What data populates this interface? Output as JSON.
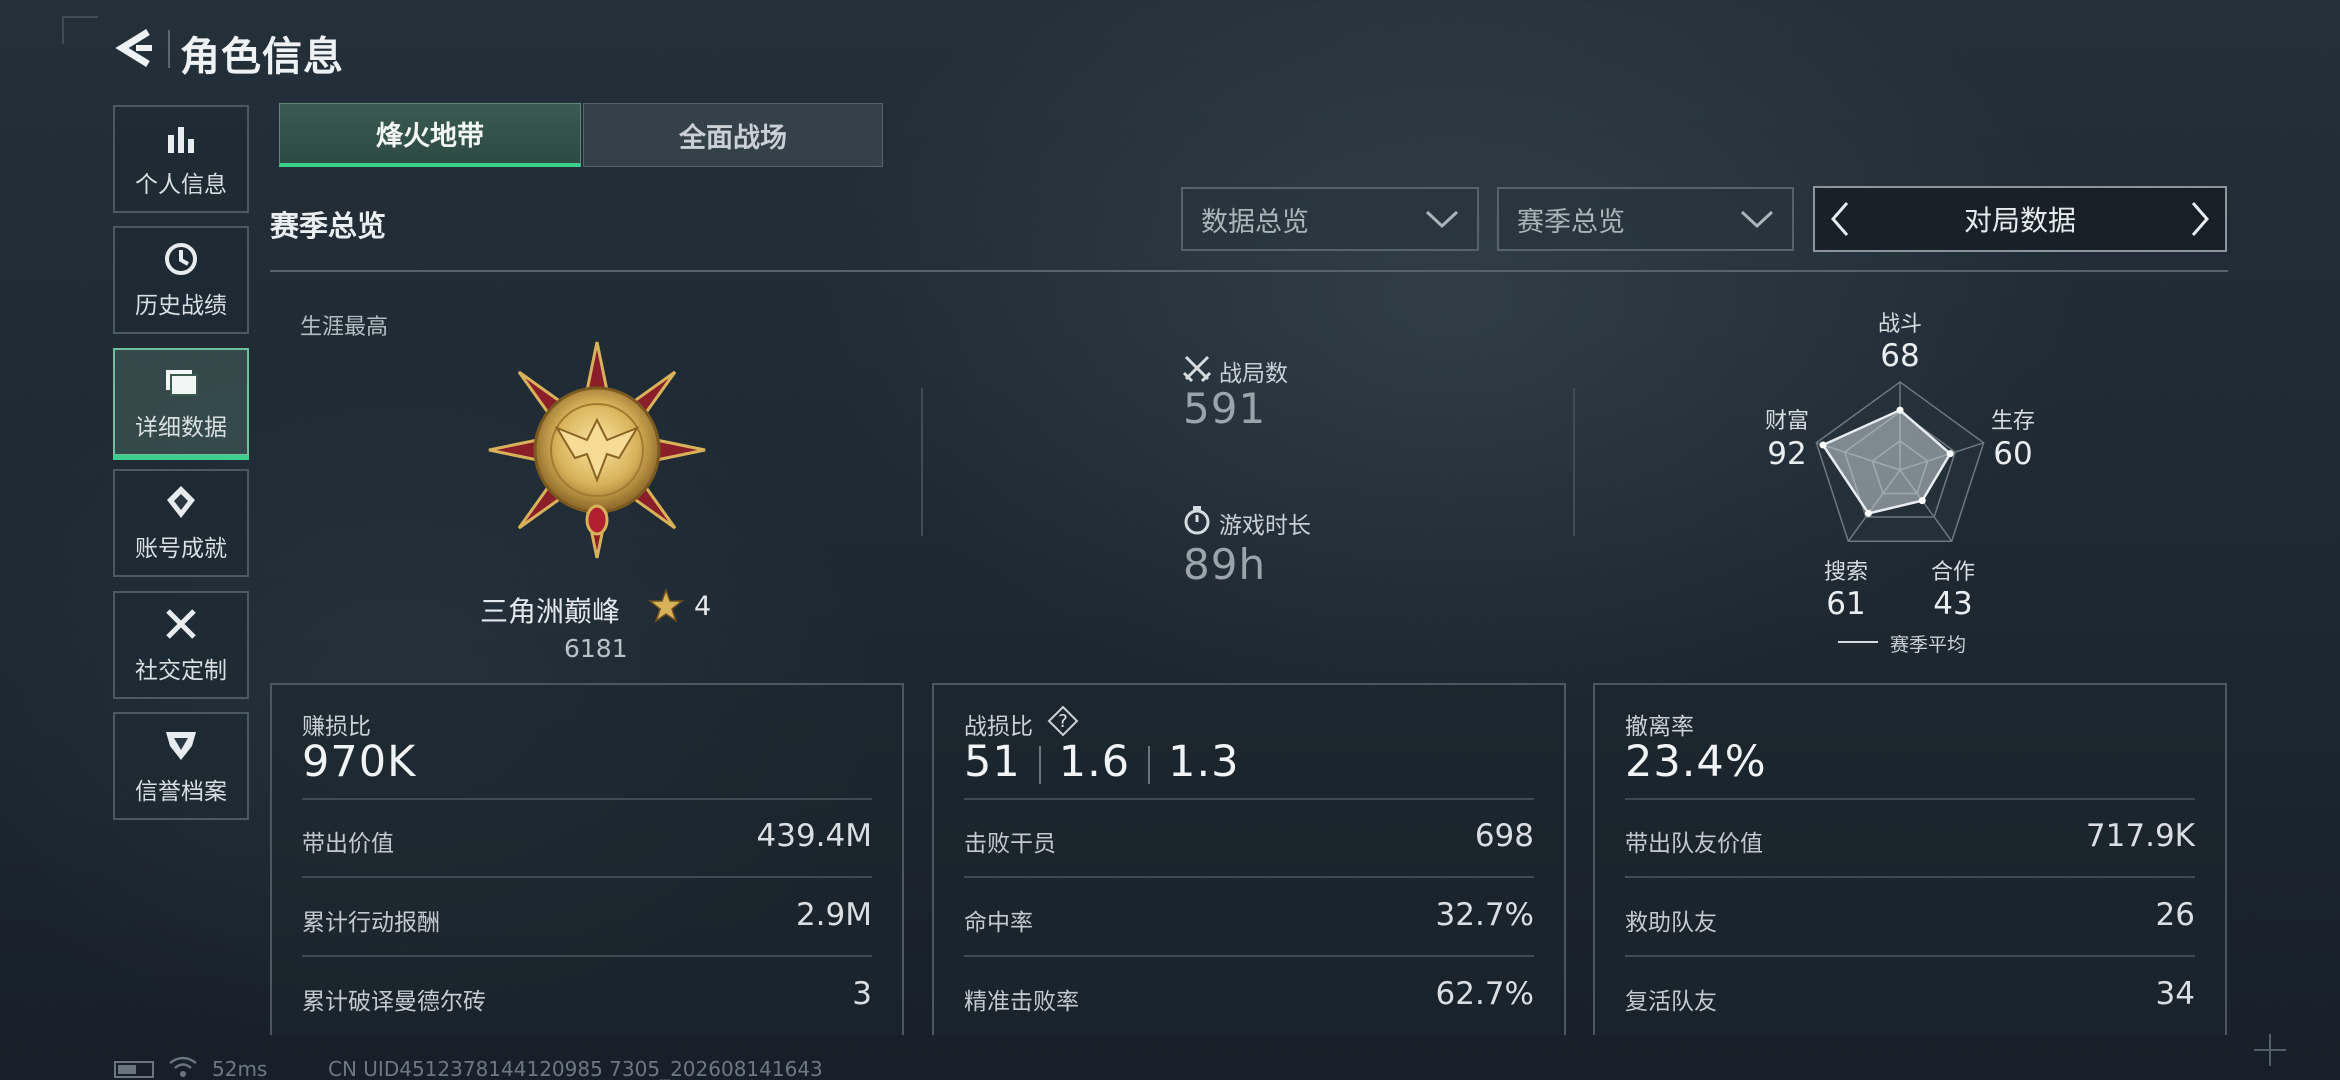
{
  "header": {
    "title": "角色信息"
  },
  "sidebar": {
    "items": [
      {
        "label": "个人信息",
        "icon": "bar-chart-icon"
      },
      {
        "label": "历史战绩",
        "icon": "clock-icon"
      },
      {
        "label": "详细数据",
        "icon": "folder-icon",
        "active": true
      },
      {
        "label": "账号成就",
        "icon": "medal-icon"
      },
      {
        "label": "社交定制",
        "icon": "tools-icon"
      },
      {
        "label": "信誉档案",
        "icon": "shield-icon"
      }
    ]
  },
  "tabs": [
    {
      "label": "烽火地带",
      "active": true
    },
    {
      "label": "全面战场",
      "active": false
    }
  ],
  "section_title": "赛季总览",
  "filters": {
    "dropdown1": "数据总览",
    "dropdown2": "赛季总览",
    "switcher": "对局数据"
  },
  "career": {
    "label": "生涯最高",
    "rank_name": "三角洲巅峰",
    "stars": "4",
    "score": "6181"
  },
  "match_stats": {
    "matches_label": "战局数",
    "matches_value": "591",
    "playtime_label": "游戏时长",
    "playtime_value": "89h"
  },
  "radar": {
    "axes": [
      {
        "label": "战斗",
        "value": "68"
      },
      {
        "label": "生存",
        "value": "60"
      },
      {
        "label": "合作",
        "value": "43"
      },
      {
        "label": "搜索",
        "value": "61"
      },
      {
        "label": "财富",
        "value": "92"
      }
    ],
    "legend": "赛季平均"
  },
  "cards": [
    {
      "title": "赚损比",
      "big": "970K",
      "rows": [
        {
          "label": "带出价值",
          "value": "439.4M"
        },
        {
          "label": "累计行动报酬",
          "value": "2.9M"
        },
        {
          "label": "累计破译曼德尔砖",
          "value": "3"
        }
      ]
    },
    {
      "title": "战损比",
      "big_parts": [
        "51",
        "1.6",
        "1.3"
      ],
      "rows": [
        {
          "label": "击败干员",
          "value": "698"
        },
        {
          "label": "命中率",
          "value": "32.7%"
        },
        {
          "label": "精准击败率",
          "value": "62.7%"
        }
      ]
    },
    {
      "title": "撤离率",
      "big": "23.4%",
      "rows": [
        {
          "label": "带出队友价值",
          "value": "717.9K"
        },
        {
          "label": "救助队友",
          "value": "26"
        },
        {
          "label": "复活队友",
          "value": "34"
        }
      ]
    }
  ],
  "footer": {
    "ping": "52ms",
    "uid": "CN UID4512378144120985 7305_202608141643"
  },
  "colors": {
    "accent": "#3ccf8e",
    "gold": "#d8b25a",
    "crimson": "#8a1f2a"
  }
}
